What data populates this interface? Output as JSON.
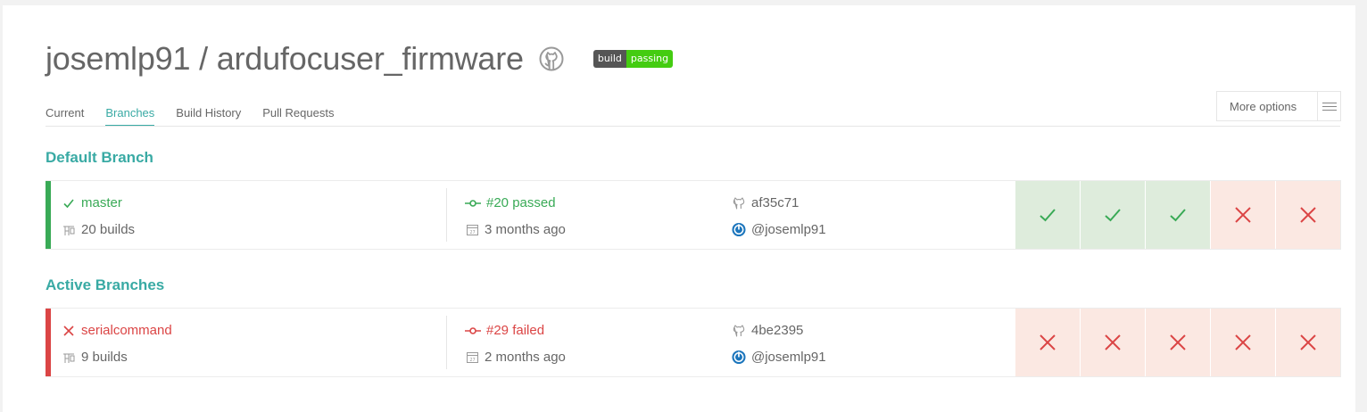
{
  "repo": {
    "title": "josemlp91 / ardufocuser_firmware",
    "badge_label": "build",
    "badge_status": "passing"
  },
  "tabs": [
    {
      "label": "Current"
    },
    {
      "label": "Branches"
    },
    {
      "label": "Build History"
    },
    {
      "label": "Pull Requests"
    }
  ],
  "more_options": {
    "label": "More options"
  },
  "sections": {
    "default": "Default Branch",
    "active": "Active Branches"
  },
  "branches": [
    {
      "name": "master",
      "builds": "20 builds",
      "build_status": "#20 passed",
      "time": "3 months ago",
      "commit": "af35c71",
      "author": "@josemlp91",
      "state": "passed",
      "history": [
        "passed",
        "passed",
        "passed",
        "failed",
        "failed"
      ]
    },
    {
      "name": "serialcommand",
      "builds": "9 builds",
      "build_status": "#29 failed",
      "time": "2 months ago",
      "commit": "4be2395",
      "author": "@josemlp91",
      "state": "failed",
      "history": [
        "failed",
        "failed",
        "failed",
        "failed",
        "failed"
      ]
    }
  ],
  "colors": {
    "accent": "#39aaa4",
    "passed": "#39aa56",
    "failed": "#db4545",
    "passed_tile": "#deecdc",
    "failed_tile": "#fbe8e2",
    "author_icon": "#1b75bc"
  }
}
